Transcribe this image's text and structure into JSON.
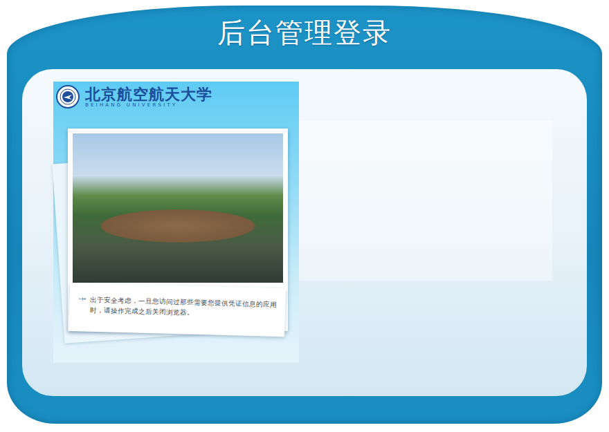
{
  "window": {
    "title": "后台管理登录"
  },
  "logo": {
    "name": "北京航空航天大学",
    "subtitle": "BEIHANG UNIVERSITY"
  },
  "notice": {
    "text": "出于安全考虑，一旦您访问过那些需要您提供凭证信息的应用时，请操作完成之后关闭浏览器。"
  }
}
